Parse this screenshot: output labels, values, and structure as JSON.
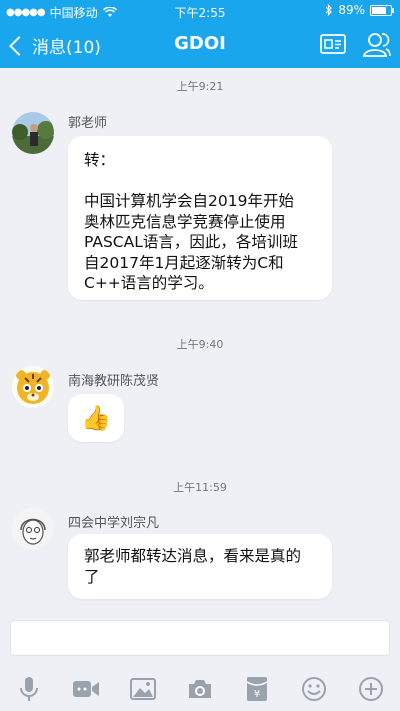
{
  "status_bar": {
    "carrier": "中国移动",
    "time": "下午2:55",
    "battery_text": "89%",
    "battery_level": 0.89
  },
  "nav": {
    "back_label": "消息(10)",
    "title": "GDOI"
  },
  "messages": [
    {
      "time": "上午9:21",
      "sender": "郭老师",
      "lines": [
        "转：",
        "中国计算机学会自2019年开始\n奥林匹克信息学竞赛停止使用\nPASCAL语言，因此，各培训班\n自2017年1月起逐渐转为C和\nC++语言的学习。"
      ]
    },
    {
      "time": "上午9:40",
      "sender": "南海教研陈茂贤",
      "emoji": "👍"
    },
    {
      "time": "上午11:59",
      "sender": "四会中学刘宗凡",
      "text": "郭老师都转达消息，看来是真的\n了"
    }
  ],
  "colors": {
    "accent": "#1aa6ec",
    "background": "#eef0f5",
    "bubble": "#ffffff",
    "toolbar_icon": "#9aa3ad"
  },
  "toolbar_icons": [
    "microphone-icon",
    "video-icon",
    "image-icon",
    "camera-icon",
    "red-packet-icon",
    "emoji-icon",
    "plus-icon"
  ]
}
